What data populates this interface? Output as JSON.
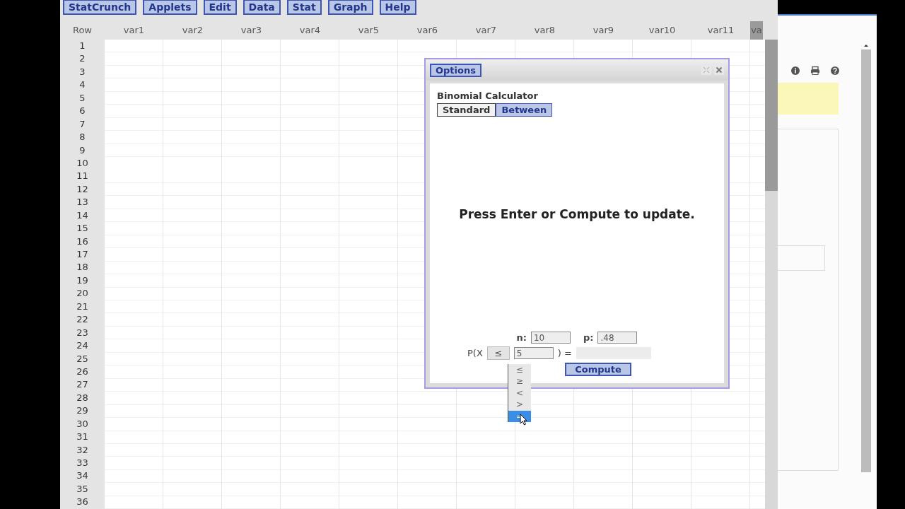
{
  "menu": [
    "StatCrunch",
    "Applets",
    "Edit",
    "Data",
    "Stat",
    "Graph",
    "Help"
  ],
  "grid": {
    "columns": [
      "Row",
      "var1",
      "var2",
      "var3",
      "var4",
      "var5",
      "var6",
      "var7",
      "var8",
      "var9",
      "var10",
      "var11",
      "va"
    ],
    "rows": [
      "1",
      "2",
      "3",
      "4",
      "5",
      "6",
      "7",
      "8",
      "9",
      "10",
      "11",
      "12",
      "13",
      "14",
      "15",
      "16",
      "17",
      "18",
      "19",
      "20",
      "21",
      "22",
      "23",
      "24",
      "25",
      "26",
      "27",
      "28",
      "29",
      "30",
      "31",
      "32",
      "33",
      "34",
      "35",
      "36"
    ]
  },
  "dialog": {
    "title": "Options",
    "heading": "Binomial Calculator",
    "tabs": [
      {
        "label": "Standard",
        "selected": false
      },
      {
        "label": "Between",
        "selected": true
      }
    ],
    "message": "Press Enter or Compute to update.",
    "n": {
      "label": "n:",
      "value": "10"
    },
    "p": {
      "label": "p:",
      "value": ".48"
    },
    "prob_prefix": "P(X",
    "operator": "≤",
    "x_value": "5",
    "prob_suffix": ") =",
    "operator_options": [
      {
        "label": "≤",
        "selected": false
      },
      {
        "label": "≥",
        "selected": false
      },
      {
        "label": "<",
        "selected": false
      },
      {
        "label": ">",
        "selected": false
      },
      {
        "label": "=",
        "selected": true
      }
    ],
    "compute": "Compute"
  }
}
